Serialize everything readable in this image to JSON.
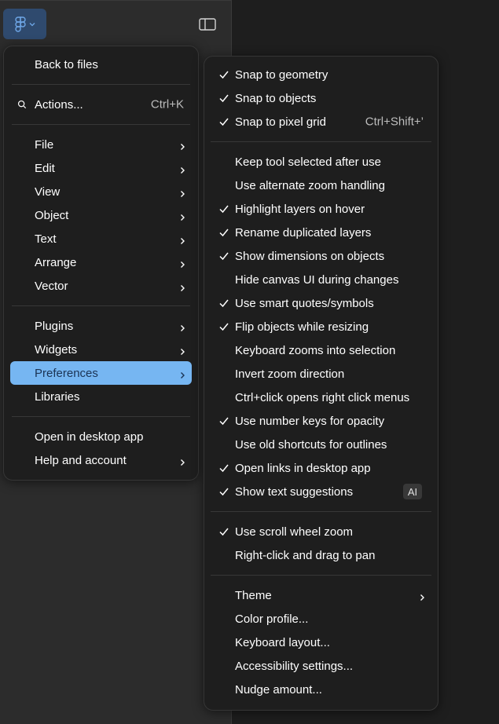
{
  "app": {
    "accent_color": "#76b6f2",
    "button_bg": "#2f4a6e",
    "toolbar": {
      "logo_icon": "figma-logo-icon",
      "sidebar_icon": "sidebar-toggle-icon"
    }
  },
  "main_menu": {
    "groups": [
      [
        {
          "label": "Back to files"
        }
      ],
      [
        {
          "label": "Actions...",
          "shortcut": "Ctrl+K",
          "icon": "search-icon"
        }
      ],
      [
        {
          "label": "File",
          "submenu": true
        },
        {
          "label": "Edit",
          "submenu": true
        },
        {
          "label": "View",
          "submenu": true
        },
        {
          "label": "Object",
          "submenu": true
        },
        {
          "label": "Text",
          "submenu": true
        },
        {
          "label": "Arrange",
          "submenu": true
        },
        {
          "label": "Vector",
          "submenu": true
        }
      ],
      [
        {
          "label": "Plugins",
          "submenu": true
        },
        {
          "label": "Widgets",
          "submenu": true
        },
        {
          "label": "Preferences",
          "submenu": true,
          "active": true
        },
        {
          "label": "Libraries"
        }
      ],
      [
        {
          "label": "Open in desktop app"
        },
        {
          "label": "Help and account",
          "submenu": true
        }
      ]
    ]
  },
  "preferences_menu": {
    "groups": [
      [
        {
          "label": "Snap to geometry",
          "checked": true
        },
        {
          "label": "Snap to objects",
          "checked": true
        },
        {
          "label": "Snap to pixel grid",
          "checked": true,
          "shortcut": "Ctrl+Shift+’"
        }
      ],
      [
        {
          "label": "Keep tool selected after use",
          "checked": false
        },
        {
          "label": "Use alternate zoom handling",
          "checked": false
        },
        {
          "label": "Highlight layers on hover",
          "checked": true
        },
        {
          "label": "Rename duplicated layers",
          "checked": true
        },
        {
          "label": "Show dimensions on objects",
          "checked": true
        },
        {
          "label": "Hide canvas UI during changes",
          "checked": false
        },
        {
          "label": "Use smart quotes/symbols",
          "checked": true
        },
        {
          "label": "Flip objects while resizing",
          "checked": true
        },
        {
          "label": "Keyboard zooms into selection",
          "checked": false
        },
        {
          "label": "Invert zoom direction",
          "checked": false
        },
        {
          "label": "Ctrl+click opens right click menus",
          "checked": false
        },
        {
          "label": "Use number keys for opacity",
          "checked": true
        },
        {
          "label": "Use old shortcuts for outlines",
          "checked": false
        },
        {
          "label": "Open links in desktop app",
          "checked": true
        },
        {
          "label": "Show text suggestions",
          "checked": true,
          "badge": "AI"
        }
      ],
      [
        {
          "label": "Use scroll wheel zoom",
          "checked": true
        },
        {
          "label": "Right-click and drag to pan",
          "checked": false
        }
      ],
      [
        {
          "label": "Theme",
          "submenu": true
        },
        {
          "label": "Color profile..."
        },
        {
          "label": "Keyboard layout..."
        },
        {
          "label": "Accessibility settings..."
        },
        {
          "label": "Nudge amount..."
        }
      ]
    ]
  }
}
